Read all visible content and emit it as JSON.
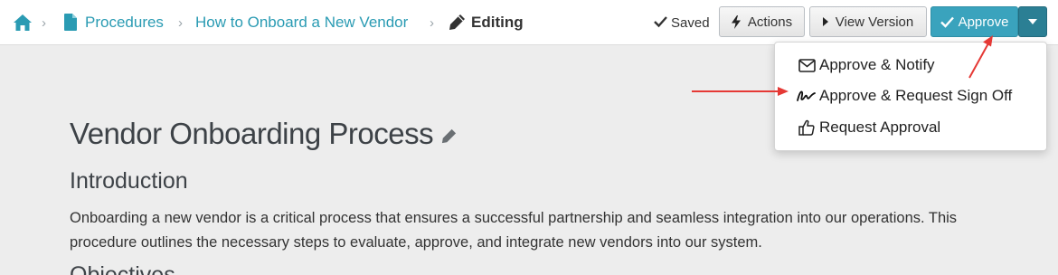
{
  "breadcrumb": {
    "items": [
      {
        "label": "Procedures"
      },
      {
        "label": "How to Onboard a New Vendor"
      }
    ],
    "current": "Editing"
  },
  "toolbar": {
    "saved_label": "Saved",
    "actions_label": "Actions",
    "view_version_label": "View Version",
    "approve_label": "Approve"
  },
  "approve_menu": {
    "items": [
      {
        "label": "Approve & Notify",
        "icon": "envelope-icon"
      },
      {
        "label": "Approve & Request Sign Off",
        "icon": "signature-icon"
      },
      {
        "label": "Request Approval",
        "icon": "thumbs-up-icon"
      }
    ]
  },
  "document": {
    "title": "Vendor Onboarding Process",
    "section_heading": "Introduction",
    "paragraph": "Onboarding a new vendor is a critical process that ensures a successful partnership and seamless integration into our operations. This procedure outlines the necessary steps to evaluate, approve, and integrate new vendors into our system.",
    "next_heading_partial": "Objectives"
  },
  "colors": {
    "accent": "#2a9bb3",
    "approve_button": "#3aa3bd",
    "annotation_arrow": "#e53935"
  }
}
